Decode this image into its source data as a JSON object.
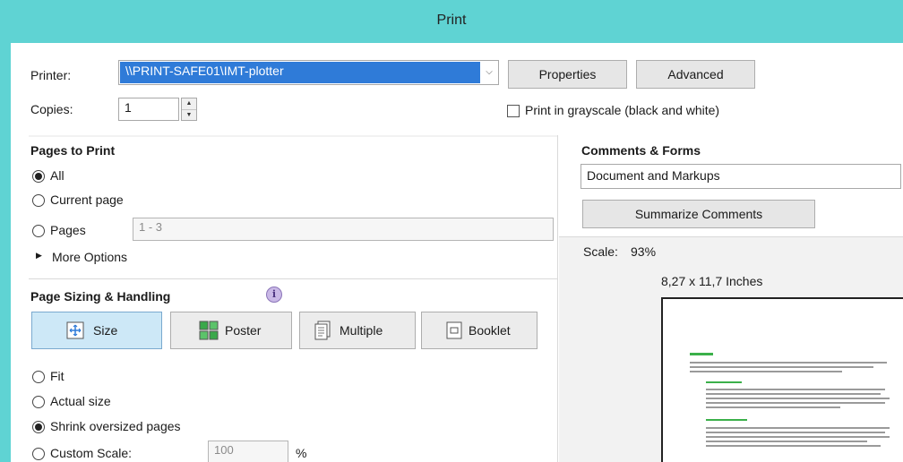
{
  "window": {
    "title": "Print"
  },
  "printer": {
    "label": "Printer:",
    "selected": "\\\\PRINT-SAFE01\\IMT-plotter",
    "properties_label": "Properties",
    "advanced_label": "Advanced"
  },
  "copies": {
    "label": "Copies:",
    "value": "1"
  },
  "grayscale": {
    "label": "Print in grayscale (black and white)",
    "checked": false
  },
  "pages_to_print": {
    "heading": "Pages to Print",
    "all_label": "All",
    "current_label": "Current page",
    "pages_label": "Pages",
    "pages_range": "1 - 3",
    "more_options_label": "More Options",
    "selected": "All"
  },
  "page_sizing": {
    "heading": "Page Sizing & Handling",
    "buttons": [
      {
        "label": "Size",
        "active": true,
        "icon": "size-icon"
      },
      {
        "label": "Poster",
        "active": false,
        "icon": "poster-icon"
      },
      {
        "label": "Multiple",
        "active": false,
        "icon": "multiple-icon"
      },
      {
        "label": "Booklet",
        "active": false,
        "icon": "booklet-icon"
      }
    ],
    "fit_label": "Fit",
    "actual_label": "Actual size",
    "shrink_label": "Shrink oversized pages",
    "custom_label": "Custom Scale:",
    "custom_value": "100",
    "custom_unit": "%",
    "selected": "Shrink oversized pages"
  },
  "comments_forms": {
    "heading": "Comments & Forms",
    "selected": "Document and Markups",
    "summarize_label": "Summarize Comments"
  },
  "preview": {
    "scale_label": "Scale:",
    "scale_value": "93%",
    "paper_size": "8,27 x 11,7 Inches"
  }
}
